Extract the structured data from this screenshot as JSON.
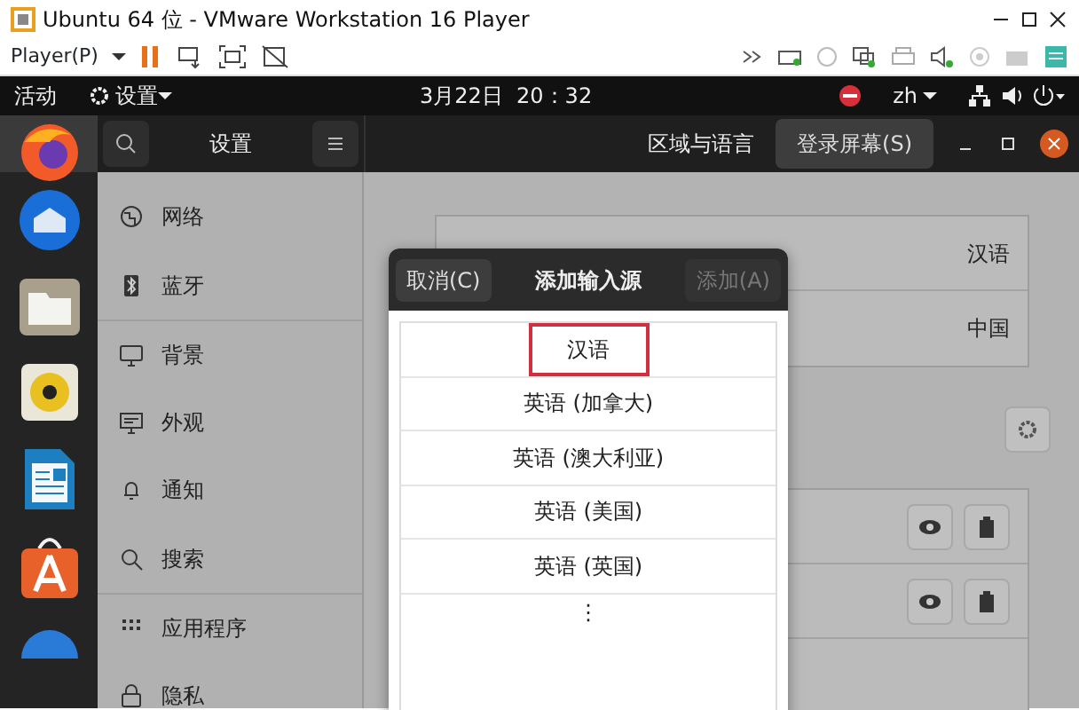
{
  "window": {
    "title": "Ubuntu 64 位 - VMware Workstation 16 Player"
  },
  "toolbar": {
    "menu": "Player(P)",
    "paused": true
  },
  "top_bar": {
    "activities": "活动",
    "app_menu": "设置",
    "clock": "3月22日  20：32",
    "input_method": "zh"
  },
  "settings_header": {
    "title": "设置",
    "page_title": "区域与语言",
    "login_button": "登录屏幕(S)"
  },
  "sidebar": {
    "items": [
      {
        "label": "网络",
        "kind": "network"
      },
      {
        "label": "蓝牙",
        "kind": "bluetooth"
      },
      {
        "label": "背景",
        "kind": "background"
      },
      {
        "label": "外观",
        "kind": "appearance"
      },
      {
        "label": "通知",
        "kind": "bell"
      },
      {
        "label": "搜索",
        "kind": "search"
      },
      {
        "label": "应用程序",
        "kind": "apps"
      },
      {
        "label": "隐私",
        "kind": "lock"
      }
    ]
  },
  "region": {
    "rows": [
      {
        "value": "汉语"
      },
      {
        "value": "中国"
      }
    ]
  },
  "dialog": {
    "cancel": "取消(C)",
    "title": "添加输入源",
    "add": {
      "label": "添加(A)",
      "disabled": true
    },
    "items": [
      {
        "label": "汉语",
        "highlighted": true
      },
      {
        "label": "英语 (加拿大)",
        "highlighted": false
      },
      {
        "label": "英语 (澳大利亚)",
        "highlighted": false
      },
      {
        "label": "英语 (美国)",
        "highlighted": false
      },
      {
        "label": "英语 (英国)",
        "highlighted": false
      }
    ],
    "more": "⋮"
  }
}
